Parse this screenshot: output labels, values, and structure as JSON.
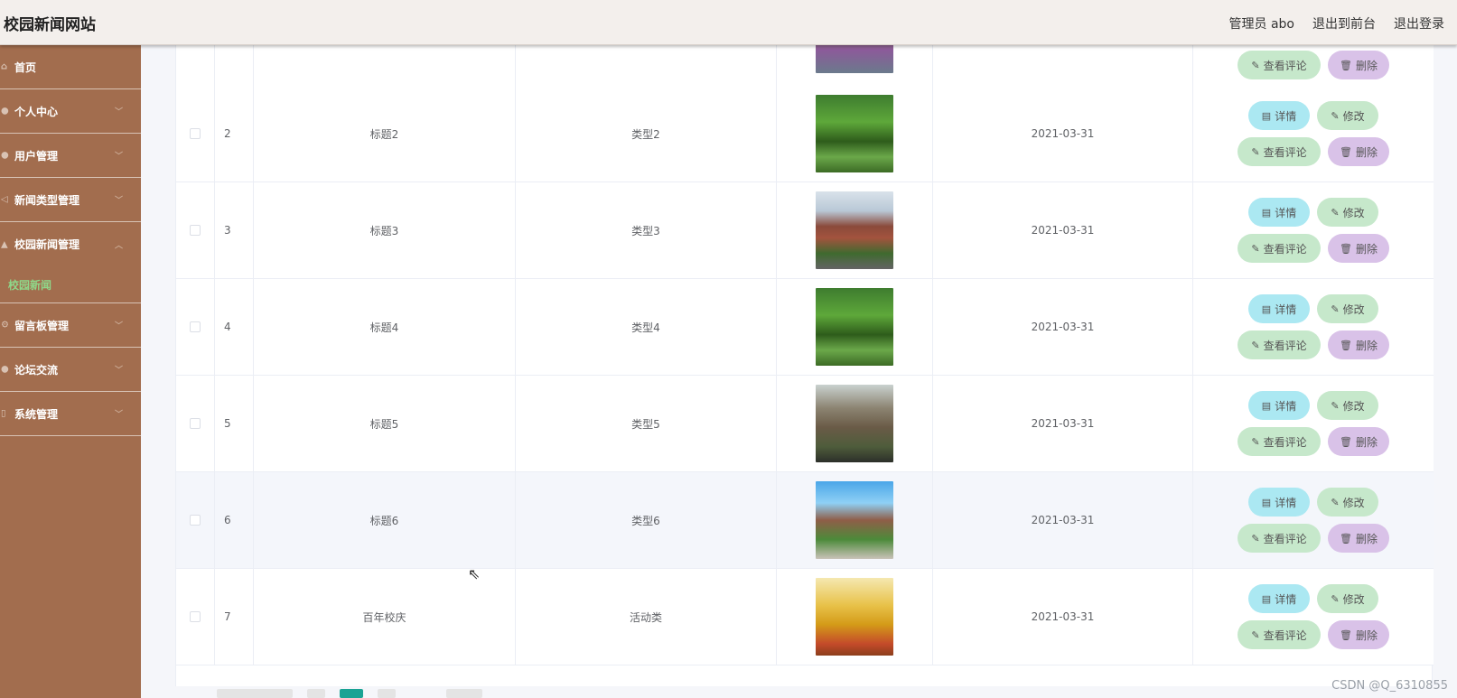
{
  "header": {
    "title": "校园新闻网站",
    "user": "管理员 abo",
    "to_front": "退出到前台",
    "logout": "退出登录"
  },
  "sidebar": {
    "items": [
      {
        "label": "首页",
        "icon": "home-icon",
        "expandable": false
      },
      {
        "label": "个人中心",
        "icon": "user-icon",
        "expandable": true
      },
      {
        "label": "用户管理",
        "icon": "users-icon",
        "expandable": true
      },
      {
        "label": "新闻类型管理",
        "icon": "send-icon",
        "expandable": true
      },
      {
        "label": "校园新闻管理",
        "icon": "school-icon",
        "expandable": true,
        "expanded": true
      },
      {
        "label": "留言板管理",
        "icon": "gear-icon",
        "expandable": true
      },
      {
        "label": "论坛交流",
        "icon": "chat-icon",
        "expandable": true
      },
      {
        "label": "系统管理",
        "icon": "settings-icon",
        "expandable": true
      }
    ],
    "active_sub": "校园新闻"
  },
  "table": {
    "rows": [
      {
        "index": "",
        "title": "",
        "type": "",
        "date": "",
        "image": "img-f",
        "partial": true
      },
      {
        "index": "2",
        "title": "标题2",
        "type": "类型2",
        "date": "2021-03-31",
        "image": "img-a"
      },
      {
        "index": "3",
        "title": "标题3",
        "type": "类型3",
        "date": "2021-03-31",
        "image": "img-b"
      },
      {
        "index": "4",
        "title": "标题4",
        "type": "类型4",
        "date": "2021-03-31",
        "image": "img-a"
      },
      {
        "index": "5",
        "title": "标题5",
        "type": "类型5",
        "date": "2021-03-31",
        "image": "img-c"
      },
      {
        "index": "6",
        "title": "标题6",
        "type": "类型6",
        "date": "2021-03-31",
        "image": "img-d",
        "hover": true
      },
      {
        "index": "7",
        "title": "百年校庆",
        "type": "活动类",
        "date": "2021-03-31",
        "image": "img-e"
      }
    ],
    "actions": {
      "detail": "详情",
      "edit": "修改",
      "comments": "查看评论",
      "delete": "删除"
    }
  },
  "watermark": "CSDN @Q_6310855",
  "colors": {
    "sidebar_bg": "#a26d4e",
    "header_bg": "#f3efec",
    "active_sub": "#8fd88a",
    "btn_detail": "#abe8f2",
    "btn_edit": "#c6e8cb",
    "btn_delete": "#d9c2e8"
  }
}
